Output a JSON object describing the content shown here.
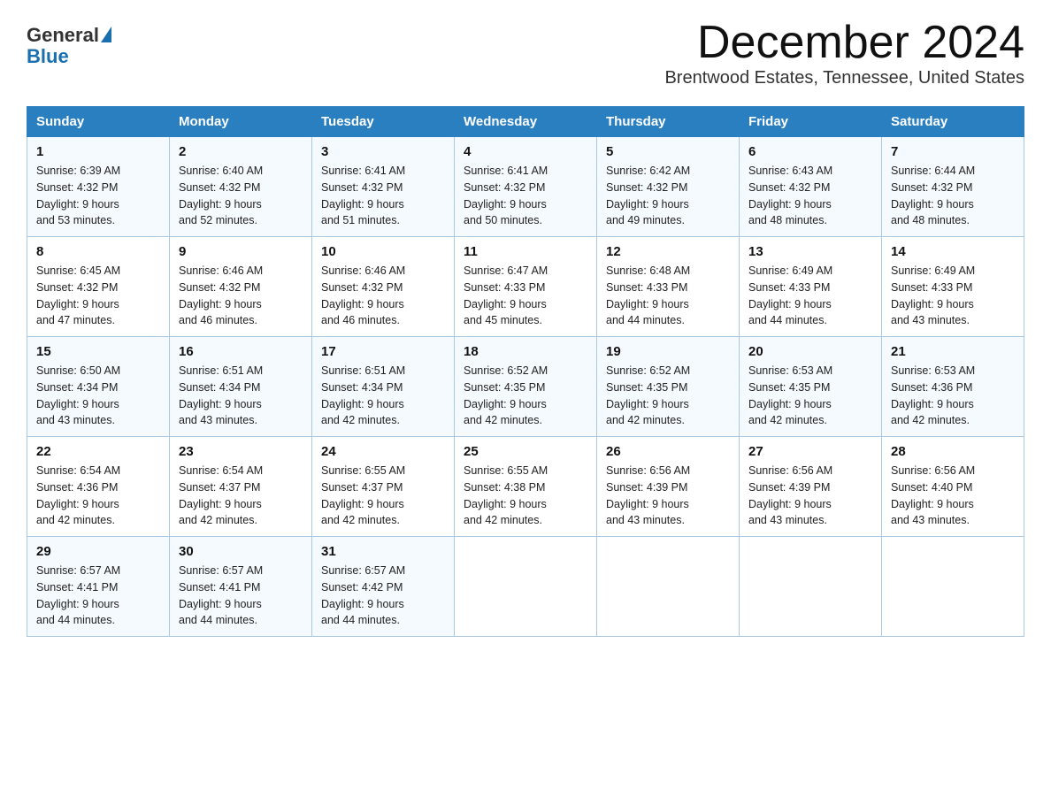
{
  "header": {
    "logo_general": "General",
    "logo_blue": "Blue",
    "month_title": "December 2024",
    "subtitle": "Brentwood Estates, Tennessee, United States"
  },
  "days_of_week": [
    "Sunday",
    "Monday",
    "Tuesday",
    "Wednesday",
    "Thursday",
    "Friday",
    "Saturday"
  ],
  "weeks": [
    [
      {
        "day": "1",
        "sunrise": "6:39 AM",
        "sunset": "4:32 PM",
        "daylight": "9 hours and 53 minutes."
      },
      {
        "day": "2",
        "sunrise": "6:40 AM",
        "sunset": "4:32 PM",
        "daylight": "9 hours and 52 minutes."
      },
      {
        "day": "3",
        "sunrise": "6:41 AM",
        "sunset": "4:32 PM",
        "daylight": "9 hours and 51 minutes."
      },
      {
        "day": "4",
        "sunrise": "6:41 AM",
        "sunset": "4:32 PM",
        "daylight": "9 hours and 50 minutes."
      },
      {
        "day": "5",
        "sunrise": "6:42 AM",
        "sunset": "4:32 PM",
        "daylight": "9 hours and 49 minutes."
      },
      {
        "day": "6",
        "sunrise": "6:43 AM",
        "sunset": "4:32 PM",
        "daylight": "9 hours and 48 minutes."
      },
      {
        "day": "7",
        "sunrise": "6:44 AM",
        "sunset": "4:32 PM",
        "daylight": "9 hours and 48 minutes."
      }
    ],
    [
      {
        "day": "8",
        "sunrise": "6:45 AM",
        "sunset": "4:32 PM",
        "daylight": "9 hours and 47 minutes."
      },
      {
        "day": "9",
        "sunrise": "6:46 AM",
        "sunset": "4:32 PM",
        "daylight": "9 hours and 46 minutes."
      },
      {
        "day": "10",
        "sunrise": "6:46 AM",
        "sunset": "4:32 PM",
        "daylight": "9 hours and 46 minutes."
      },
      {
        "day": "11",
        "sunrise": "6:47 AM",
        "sunset": "4:33 PM",
        "daylight": "9 hours and 45 minutes."
      },
      {
        "day": "12",
        "sunrise": "6:48 AM",
        "sunset": "4:33 PM",
        "daylight": "9 hours and 44 minutes."
      },
      {
        "day": "13",
        "sunrise": "6:49 AM",
        "sunset": "4:33 PM",
        "daylight": "9 hours and 44 minutes."
      },
      {
        "day": "14",
        "sunrise": "6:49 AM",
        "sunset": "4:33 PM",
        "daylight": "9 hours and 43 minutes."
      }
    ],
    [
      {
        "day": "15",
        "sunrise": "6:50 AM",
        "sunset": "4:34 PM",
        "daylight": "9 hours and 43 minutes."
      },
      {
        "day": "16",
        "sunrise": "6:51 AM",
        "sunset": "4:34 PM",
        "daylight": "9 hours and 43 minutes."
      },
      {
        "day": "17",
        "sunrise": "6:51 AM",
        "sunset": "4:34 PM",
        "daylight": "9 hours and 42 minutes."
      },
      {
        "day": "18",
        "sunrise": "6:52 AM",
        "sunset": "4:35 PM",
        "daylight": "9 hours and 42 minutes."
      },
      {
        "day": "19",
        "sunrise": "6:52 AM",
        "sunset": "4:35 PM",
        "daylight": "9 hours and 42 minutes."
      },
      {
        "day": "20",
        "sunrise": "6:53 AM",
        "sunset": "4:35 PM",
        "daylight": "9 hours and 42 minutes."
      },
      {
        "day": "21",
        "sunrise": "6:53 AM",
        "sunset": "4:36 PM",
        "daylight": "9 hours and 42 minutes."
      }
    ],
    [
      {
        "day": "22",
        "sunrise": "6:54 AM",
        "sunset": "4:36 PM",
        "daylight": "9 hours and 42 minutes."
      },
      {
        "day": "23",
        "sunrise": "6:54 AM",
        "sunset": "4:37 PM",
        "daylight": "9 hours and 42 minutes."
      },
      {
        "day": "24",
        "sunrise": "6:55 AM",
        "sunset": "4:37 PM",
        "daylight": "9 hours and 42 minutes."
      },
      {
        "day": "25",
        "sunrise": "6:55 AM",
        "sunset": "4:38 PM",
        "daylight": "9 hours and 42 minutes."
      },
      {
        "day": "26",
        "sunrise": "6:56 AM",
        "sunset": "4:39 PM",
        "daylight": "9 hours and 43 minutes."
      },
      {
        "day": "27",
        "sunrise": "6:56 AM",
        "sunset": "4:39 PM",
        "daylight": "9 hours and 43 minutes."
      },
      {
        "day": "28",
        "sunrise": "6:56 AM",
        "sunset": "4:40 PM",
        "daylight": "9 hours and 43 minutes."
      }
    ],
    [
      {
        "day": "29",
        "sunrise": "6:57 AM",
        "sunset": "4:41 PM",
        "daylight": "9 hours and 44 minutes."
      },
      {
        "day": "30",
        "sunrise": "6:57 AM",
        "sunset": "4:41 PM",
        "daylight": "9 hours and 44 minutes."
      },
      {
        "day": "31",
        "sunrise": "6:57 AM",
        "sunset": "4:42 PM",
        "daylight": "9 hours and 44 minutes."
      },
      null,
      null,
      null,
      null
    ]
  ],
  "labels": {
    "sunrise": "Sunrise:",
    "sunset": "Sunset:",
    "daylight": "Daylight:"
  }
}
